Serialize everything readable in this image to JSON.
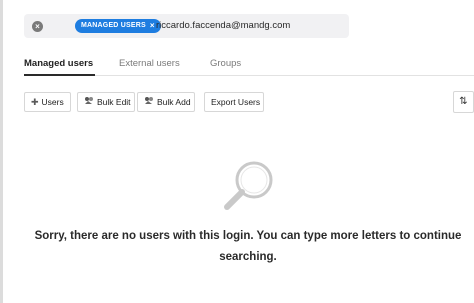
{
  "search": {
    "chip_label": "MANAGED USERS",
    "chip_close": "×",
    "query": "riccardo.faccenda@mandg.com"
  },
  "tabs": [
    {
      "label": "Managed users",
      "active": true
    },
    {
      "label": "External users",
      "active": false
    },
    {
      "label": "Groups",
      "active": false
    }
  ],
  "toolbar": {
    "users_label": "Users",
    "bulk_edit_label": "Bulk Edit",
    "bulk_add_label": "Bulk Add",
    "export_label": "Export Users"
  },
  "empty_state": {
    "message": "Sorry, there are no users with this login. You can type more letters to continue searching."
  },
  "colors": {
    "chip_bg": "#1e7de0",
    "search_bg": "#f1f1f3"
  },
  "icons": [
    "clear-icon",
    "plus-icon",
    "bulk-edit-icon",
    "bulk-add-icon",
    "sort-icon",
    "magnifier-icon"
  ]
}
